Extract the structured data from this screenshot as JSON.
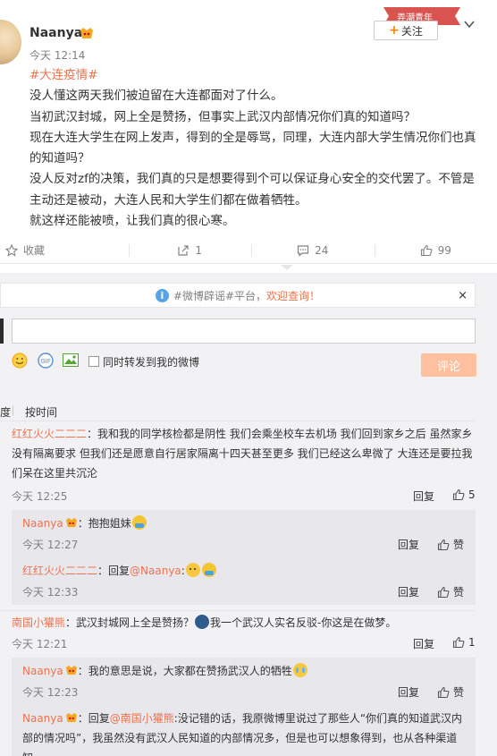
{
  "post": {
    "author": "Naanya",
    "time": "今天 12:14",
    "ribbon_text": "弄潮青年",
    "follow_label": "关注",
    "hashtag": "#大连疫情#",
    "lines": [
      "没人懂这两天我们被迫留在大连都面对了什么。",
      "当初武汉封城，网上全是赞扬，但事实上武汉内部情况你们真的知道吗？",
      "现在大连大学生在网上发声，得到的全是辱骂，同理，大连内部大学生情况你们也真的知道吗？",
      "没人反对zf的决策，我们真的只是想要得到个可以保证身心安全的交代罢了。不管是主动还是被动，大连人民和大学生们都在做着牺牲。",
      "就这样还能被喷，让我们真的很心寒。"
    ]
  },
  "actions": {
    "collect": "收藏",
    "forward_count": "1",
    "comment_count": "24",
    "like_count": "99"
  },
  "notice": {
    "prefix": "#微博辟谣#平台，",
    "highlight": "欢迎查询！",
    "close": "×"
  },
  "composer": {
    "placeholder": "",
    "forward_label": "同时转发到我的微博",
    "submit_label": "评论"
  },
  "sort": {
    "hot_partial": "度",
    "by_time": "按时间"
  },
  "comments": {
    "c1": {
      "name": "红红火火二二二",
      "text": "：我和我的同学核检都是阴性 我们会乘坐校车去机场 我们回到家乡之后 虽然家乡没有隔离要求 但我们还是愿意自行居家隔离十四天甚至更多 我们已经这么卑微了 大连还是要拉我们呆在这里共沉沦",
      "time": "今天 12:25",
      "reply": "回复",
      "likes": "5"
    },
    "r1": {
      "name": "Naanya",
      "text": "：抱抱姐妹",
      "time": "今天 12:27",
      "reply": "回复",
      "likes": "赞"
    },
    "r2": {
      "name": "红红火火二二二",
      "text_pre": "：回复",
      "at": "@Naanya",
      "text_post": ":",
      "time": "今天 12:33",
      "reply": "回复",
      "likes": "赞"
    },
    "c2": {
      "name": "南国小獾熊",
      "text": "：武汉封城网上全是赞扬？",
      "text_post": "我一个武汉人实名反驳-你这是在做梦。",
      "time": "今天 12:21",
      "reply": "回复",
      "likes": "1"
    },
    "r3": {
      "name": "Naanya",
      "text": "：我的意思是说，大家都在赞扬武汉人的牺牲",
      "time": "今天 12:23",
      "reply": "回复",
      "likes": "赞"
    },
    "r4": {
      "name": "Naanya",
      "text_pre": "：回复",
      "at": "@南国小獾熊",
      "text_post": ":没记错的话，我原微博里说过了那些人“你们真的知道武汉内部的情况吗”，我虽然没有武汉人民知道的内部情况多，但是也可以想象得到，也从各种渠道知"
    }
  }
}
